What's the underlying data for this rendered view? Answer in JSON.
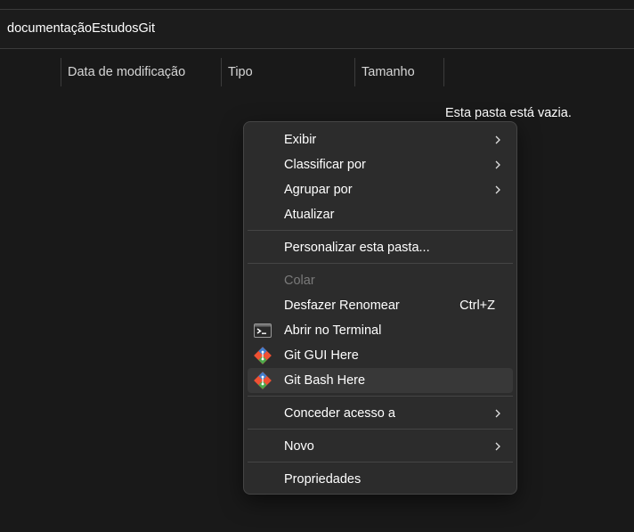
{
  "address": {
    "folder": "documentaçãoEstudosGit"
  },
  "columns": {
    "date": "Data de modificação",
    "type": "Tipo",
    "size": "Tamanho"
  },
  "content": {
    "empty_message": "Esta pasta está vazia."
  },
  "context_menu": {
    "view": "Exibir",
    "sort_by": "Classificar por",
    "group_by": "Agrupar por",
    "refresh": "Atualizar",
    "customize": "Personalizar esta pasta...",
    "paste": "Colar",
    "undo_rename": "Desfazer Renomear",
    "undo_shortcut": "Ctrl+Z",
    "open_terminal": "Abrir no Terminal",
    "git_gui": "Git GUI Here",
    "git_bash": "Git Bash Here",
    "give_access": "Conceder acesso a",
    "new": "Novo",
    "properties": "Propriedades"
  },
  "icons": {
    "submenu": "chevron-right-icon",
    "terminal": "terminal-icon",
    "git": "git-icon"
  },
  "colors": {
    "background": "#191919",
    "menu_background": "#2c2c2c",
    "menu_hover": "#383838",
    "disabled_text": "#7a7a7a",
    "git_orange": "#f05133"
  }
}
